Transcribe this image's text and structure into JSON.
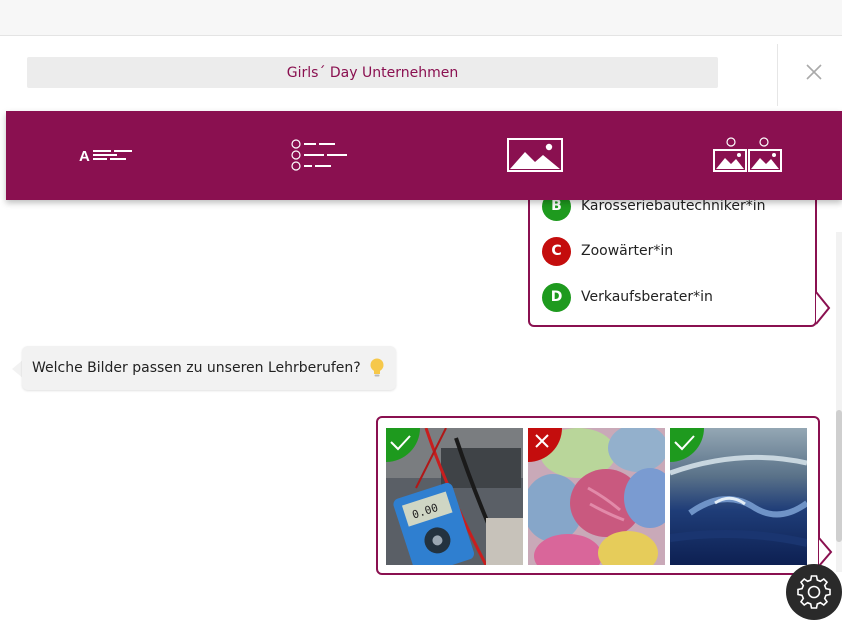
{
  "header": {
    "title": "Girls´ Day Unternehmen"
  },
  "toolbar": {
    "tools": [
      {
        "name": "text-answer-tool",
        "icon": "text-lines-icon"
      },
      {
        "name": "multiple-choice-tool",
        "icon": "abc-list-icon"
      },
      {
        "name": "image-tool",
        "icon": "image-icon"
      },
      {
        "name": "image-choice-tool",
        "icon": "image-ab-icon"
      }
    ]
  },
  "answers": [
    {
      "letter": "B",
      "text": "Karosseriebautechniker*in",
      "color": "#1e9a1e"
    },
    {
      "letter": "C",
      "text": "Zoowärter*in",
      "color": "#c40d0d"
    },
    {
      "letter": "D",
      "text": "Verkaufsberater*in",
      "color": "#1e9a1e"
    }
  ],
  "question": {
    "text": "Welche Bilder passen zu unseren Lehrberufen?",
    "icon": "lightbulb-icon"
  },
  "images": [
    {
      "subject": "multimeter-photo",
      "status": "correct"
    },
    {
      "subject": "towels-photo",
      "status": "wrong"
    },
    {
      "subject": "car-paint-photo",
      "status": "correct"
    }
  ],
  "colors": {
    "brand": "#8a1050",
    "correct": "#1e9a1e",
    "wrong": "#c40d0d"
  }
}
